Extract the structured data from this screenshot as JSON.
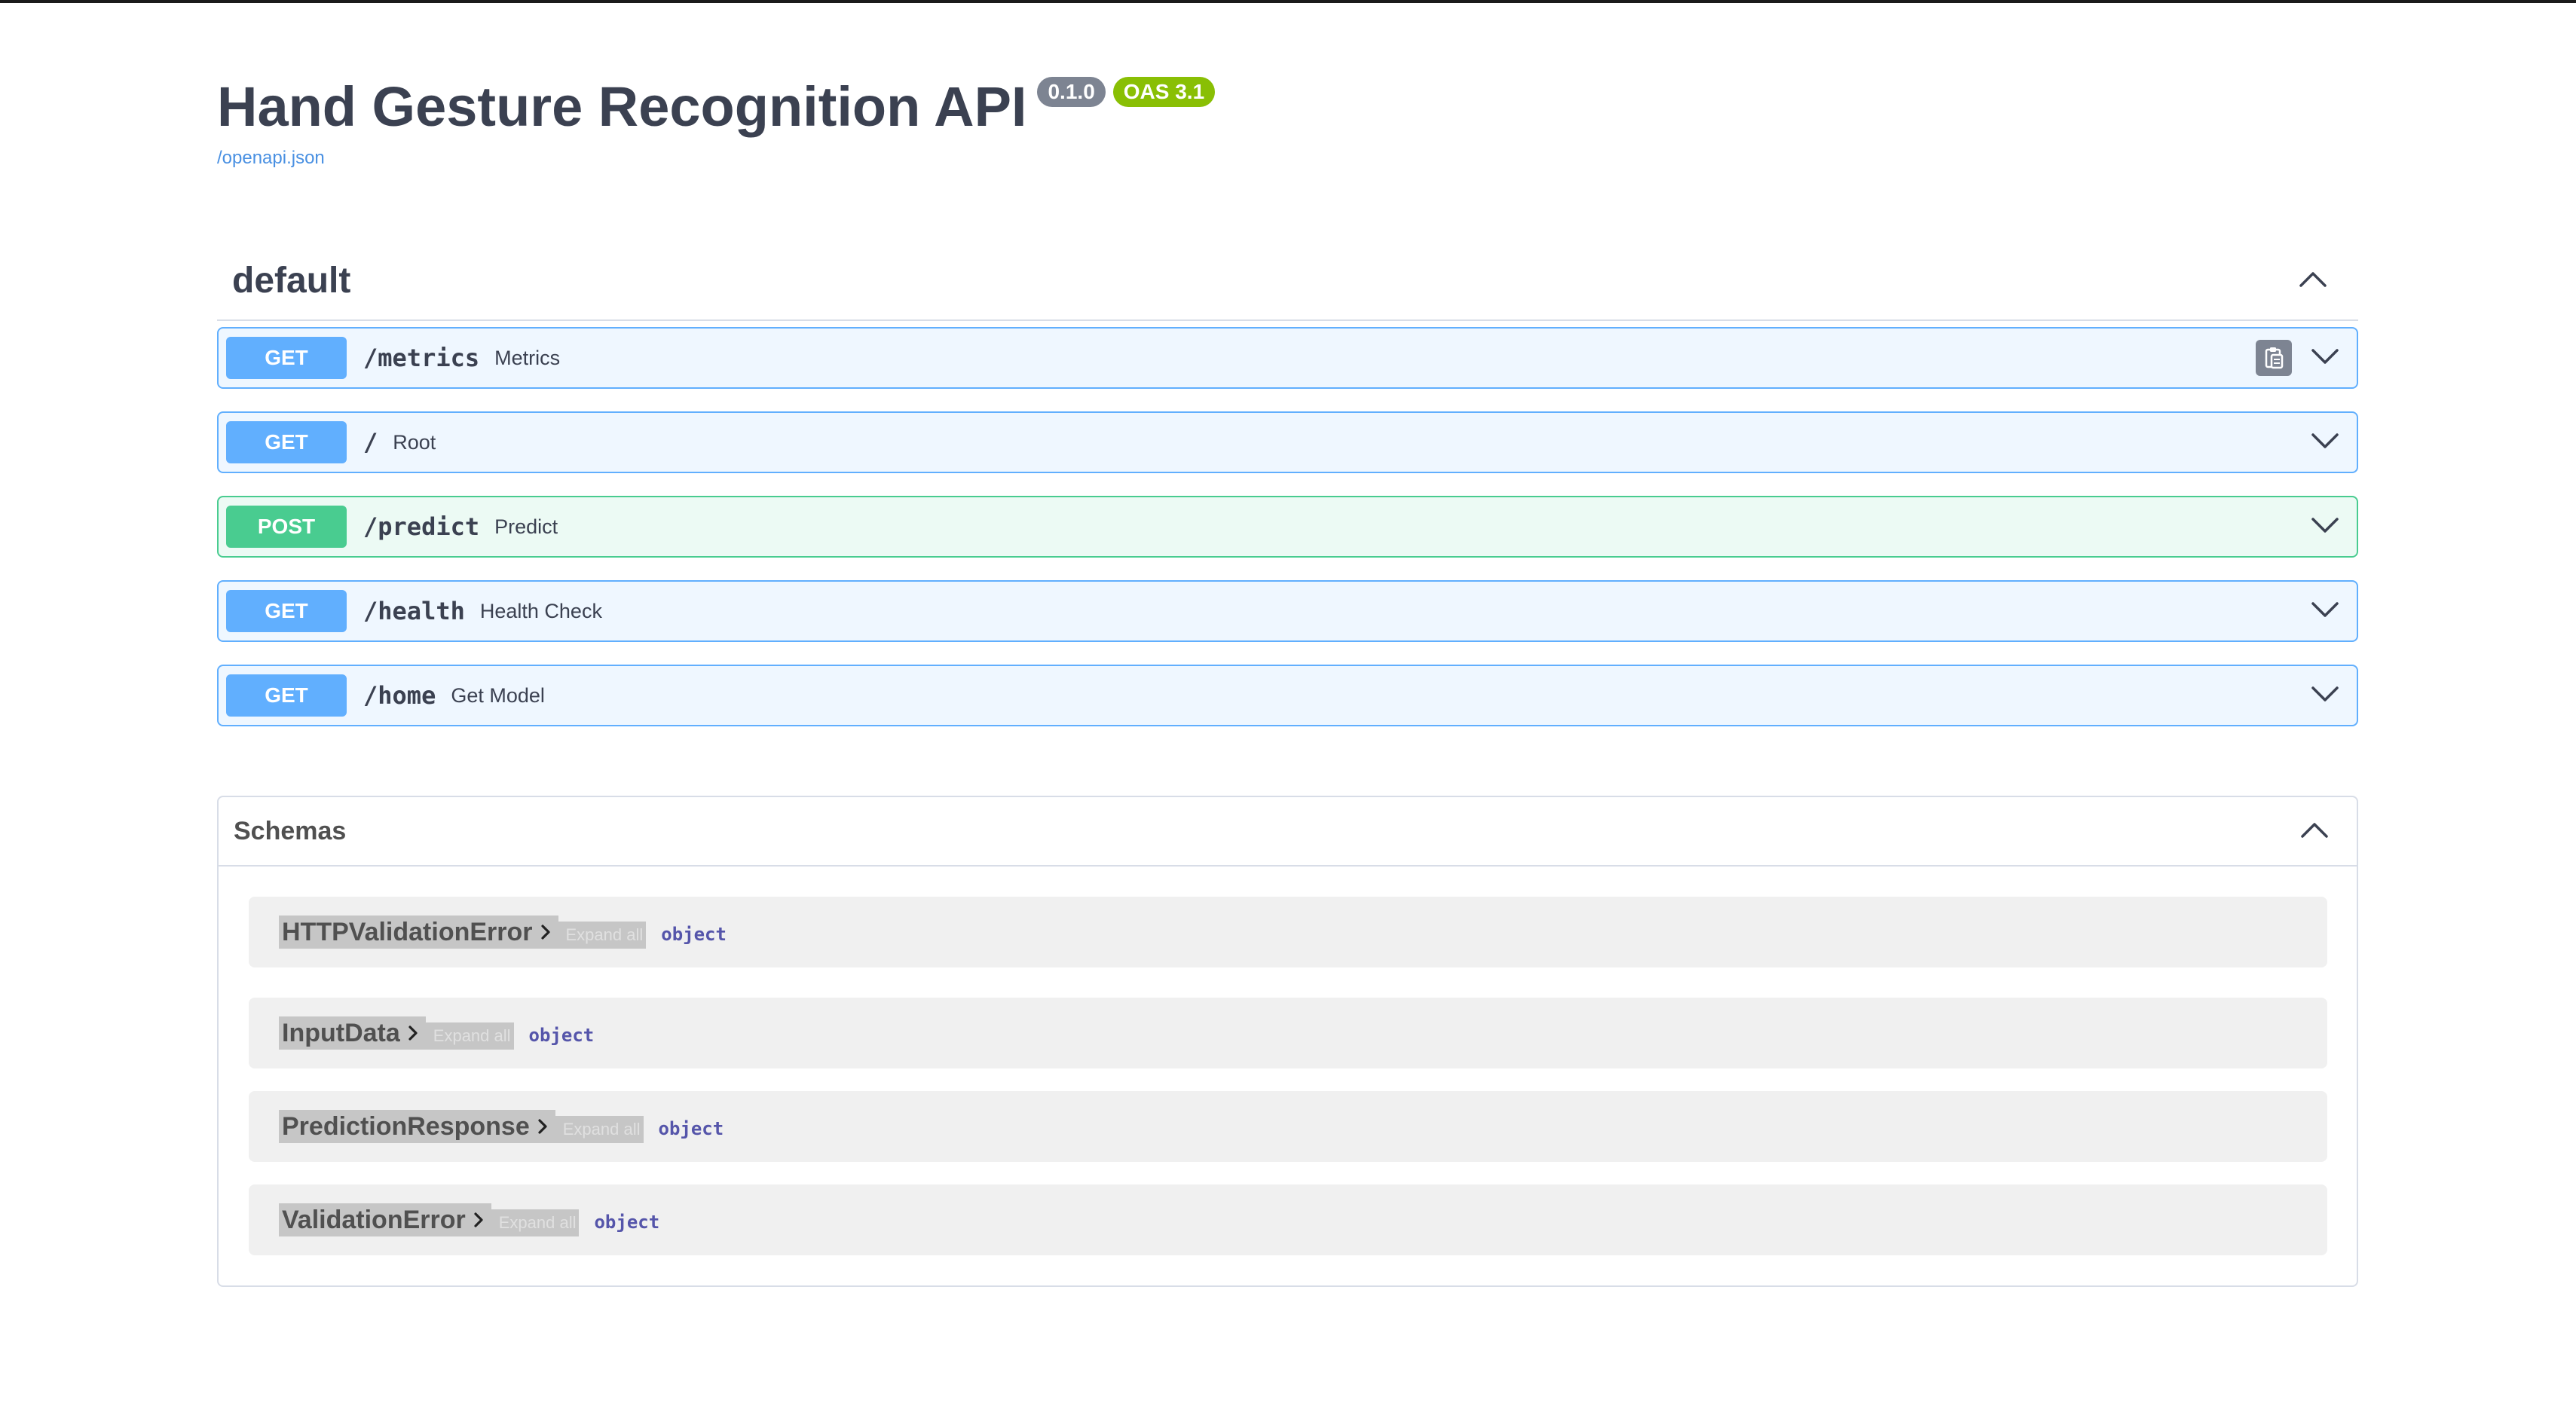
{
  "info": {
    "title": "Hand Gesture Recognition API",
    "version": "0.1.0",
    "oas_version": "OAS 3.1",
    "spec_link": "/openapi.json"
  },
  "tag": {
    "name": "default"
  },
  "operations": [
    {
      "method": "GET",
      "path": "/metrics",
      "summary": "Metrics"
    },
    {
      "method": "GET",
      "path": "/",
      "summary": "Root"
    },
    {
      "method": "POST",
      "path": "/predict",
      "summary": "Predict"
    },
    {
      "method": "GET",
      "path": "/health",
      "summary": "Health Check"
    },
    {
      "method": "GET",
      "path": "/home",
      "summary": "Get Model"
    }
  ],
  "schemas": {
    "title": "Schemas",
    "expand_all_label": "Expand all",
    "items": [
      {
        "name": "HTTPValidationError",
        "type": "object"
      },
      {
        "name": "InputData",
        "type": "object"
      },
      {
        "name": "PredictionResponse",
        "type": "object"
      },
      {
        "name": "ValidationError",
        "type": "object"
      }
    ]
  },
  "colors": {
    "get": "#61affe",
    "post": "#49cc90",
    "version_badge": "#7d8492",
    "oas_badge": "#89bf04",
    "link": "#4990e2"
  },
  "icons": {
    "collapse": "chevron-up-icon",
    "expand": "chevron-down-icon",
    "copy": "clipboard-icon",
    "model_toggle": "chevron-right-icon"
  }
}
